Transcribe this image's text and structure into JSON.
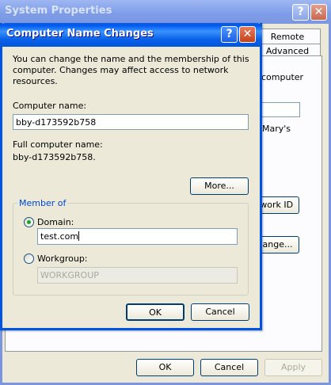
{
  "background_window": {
    "title": "System Properties",
    "tabs": [
      {
        "label": "Remote"
      },
      {
        "label": "Advanced"
      }
    ],
    "partial_texts": {
      "computer": "computer",
      "marys": "Mary's"
    },
    "buttons": {
      "network_id": "twork ID",
      "change": "hange...",
      "ok": "OK",
      "cancel": "Cancel",
      "apply": "Apply"
    }
  },
  "dialog": {
    "title": "Computer Name Changes",
    "description": "You can change the name and the membership of this computer. Changes may affect access to network resources.",
    "computer_name_label": "Computer name:",
    "computer_name_value": "bby-d173592b758",
    "full_name_label": "Full computer name:",
    "full_name_value": "bby-d173592b758.",
    "more_button": "More...",
    "member_of": {
      "legend": "Member of",
      "domain_label": "Domain:",
      "domain_value": "test.com",
      "domain_selected": true,
      "workgroup_label": "Workgroup:",
      "workgroup_value": "WORKGROUP",
      "workgroup_selected": false
    },
    "ok_button": "OK",
    "cancel_button": "Cancel"
  },
  "caption_icons": {
    "help": "?",
    "close": "✕"
  }
}
